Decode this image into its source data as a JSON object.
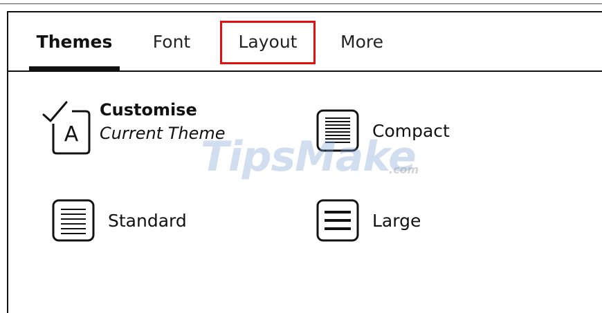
{
  "tabs": {
    "themes": "Themes",
    "font": "Font",
    "layout": "Layout",
    "more": "More",
    "active": "Themes",
    "highlighted": "Layout"
  },
  "options": {
    "customise": {
      "title": "Customise",
      "subtitle": "Current Theme",
      "icon": "checked-theme-A-icon"
    },
    "compact": {
      "label": "Compact",
      "icon": "compact-lines-icon"
    },
    "standard": {
      "label": "Standard",
      "icon": "standard-lines-icon"
    },
    "large": {
      "label": "Large",
      "icon": "large-lines-icon"
    }
  },
  "watermark": {
    "main": "TipsMake",
    "sub": ".com"
  },
  "colors": {
    "highlight": "#e01010",
    "text": "#111111"
  }
}
